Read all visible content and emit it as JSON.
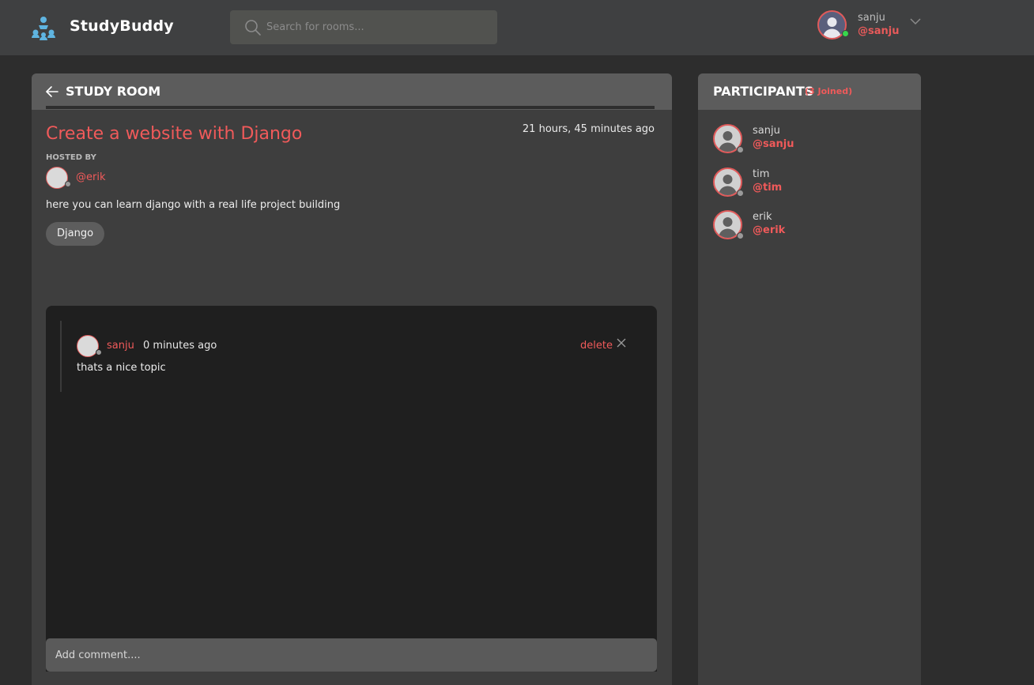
{
  "header": {
    "brand": "StudyBuddy",
    "search_placeholder": "Search for rooms...",
    "user": {
      "name": "sanju",
      "handle": "@sanju"
    }
  },
  "room": {
    "header_title": "STUDY ROOM",
    "title": "Create a website with Django",
    "time": "21 hours, 45 minutes ago",
    "hosted_by_label": "HOSTED BY",
    "host_handle": "@erik",
    "description": "here you can learn django with a real life project building",
    "topic": "Django",
    "messages": [
      {
        "author": "sanju",
        "time": "0 minutes ago",
        "action": "delete",
        "body": "thats a nice topic"
      }
    ],
    "comment_placeholder": "Add comment...."
  },
  "participants": {
    "title": "PARTICIPANTS",
    "count_label": "(3 Joined)",
    "items": [
      {
        "name": "sanju",
        "handle": "@sanju"
      },
      {
        "name": "tim",
        "handle": "@tim"
      },
      {
        "name": "erik",
        "handle": "@erik"
      }
    ]
  },
  "colors": {
    "accent": "#f05a5a",
    "logo": "#5fb4e0",
    "online": "#37d64c",
    "background": "#2d2d2d",
    "header": "#3f4041"
  },
  "icons": [
    "logo-icon",
    "search-icon",
    "chevron-down-icon",
    "back-arrow-icon",
    "close-icon",
    "avatar-icon"
  ]
}
